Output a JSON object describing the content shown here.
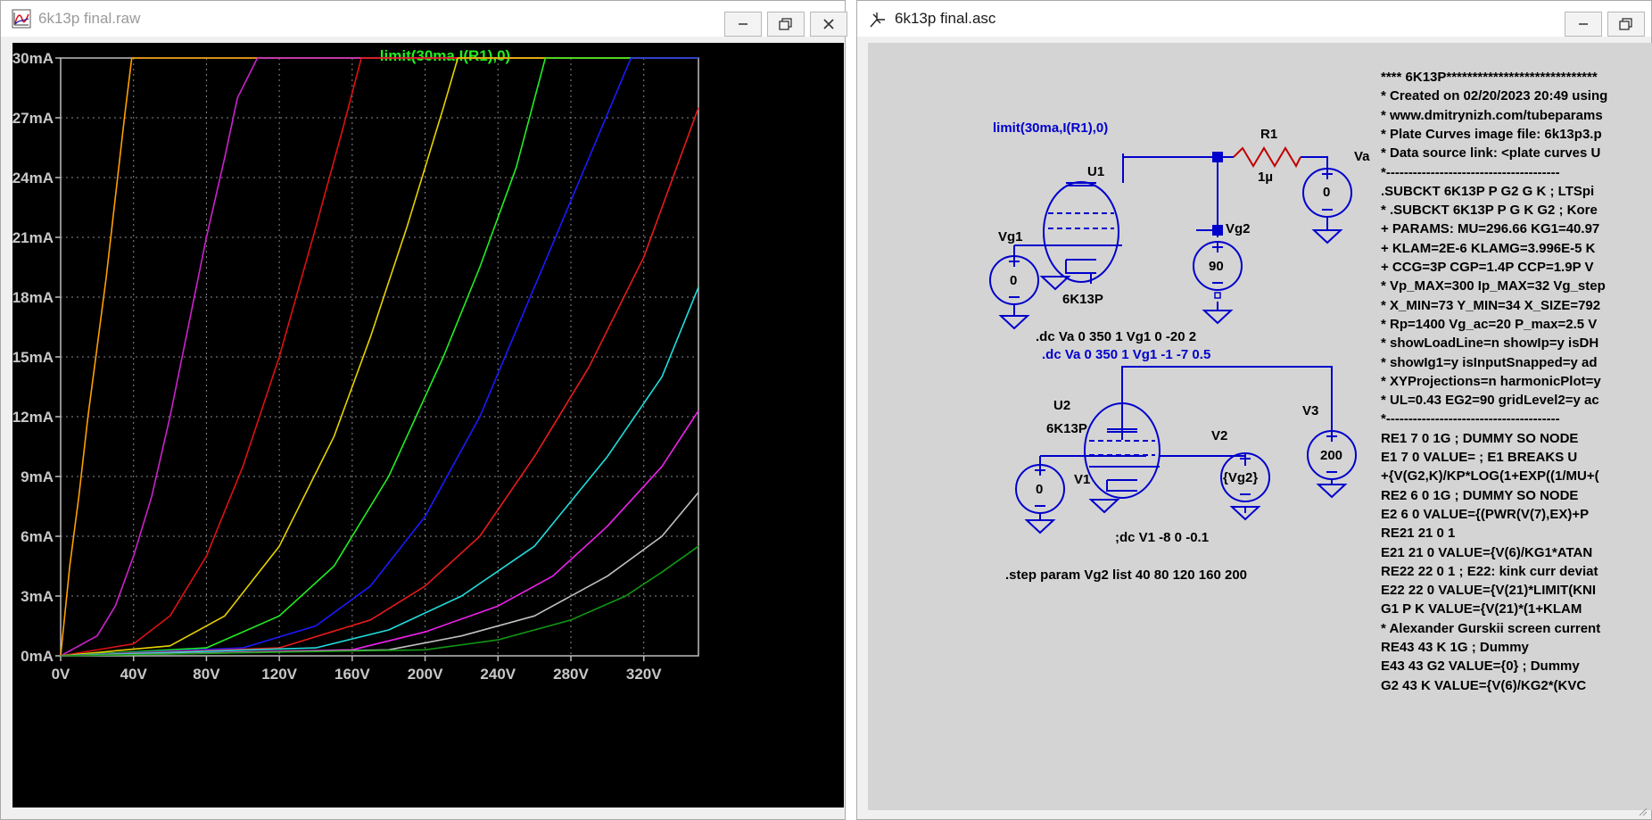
{
  "plot_window": {
    "title": "6k13p final.raw",
    "trace_label": "limit(30ma,I(R1),0)"
  },
  "schematic_window": {
    "title": "6k13p final.asc",
    "labels": {
      "expr": "limit(30ma,I(R1),0)",
      "r1": "R1",
      "r1_value": "1µ",
      "va": "Va",
      "va_value": "0",
      "u1": "U1",
      "u1_model": "6K13P",
      "vg1": "Vg1",
      "vg1_value": "0",
      "vg2": "Vg2",
      "vg2_value": "90",
      "dc1": ".dc Va 0 350 1 Vg1 0 -20 2",
      "dc2": ".dc Va 0 350 1 Vg1 -1 -7 0.5",
      "u2": "U2",
      "u2_model": "6K13P",
      "v1": "V1",
      "v1_value": "0",
      "v2": "V2",
      "v2_value": "{Vg2}",
      "v3": "V3",
      "v3_value": "200",
      "dc3": ";dc V1 -8 0 -0.1",
      "step": ".step param Vg2 list 40 80 120 160 200"
    },
    "netlist": [
      "**** 6K13P*****************************",
      "* Created on 02/20/2023 20:49 using",
      "* www.dmitrynizh.com/tubeparams",
      "* Plate Curves image file: 6k13p3.p",
      "* Data source link: <plate curves U",
      "*---------------------------------------",
      ".SUBCKT 6K13P P G2 G K ; LTSpi",
      "* .SUBCKT 6K13P P G K G2 ; Kore",
      "+ PARAMS: MU=296.66 KG1=40.97",
      "+ KLAM=2E-6 KLAMG=3.996E-5 K",
      "+ CCG=3P CGP=1.4P CCP=1.9P V",
      "* Vp_MAX=300 Ip_MAX=32 Vg_step",
      "* X_MIN=73 Y_MIN=34 X_SIZE=792",
      "* Rp=1400 Vg_ac=20 P_max=2.5 V",
      "* showLoadLine=n showIp=y isDH",
      "* showIg1=y isInputSnapped=y ad",
      "* XYProjections=n harmonicPlot=y",
      "* UL=0.43 EG2=90 gridLevel2=y ac",
      "*---------------------------------------",
      "RE1  7 0  1G    ; DUMMY SO NODE",
      "E1   7 0  VALUE=  ; E1 BREAKS U",
      "+{V(G2,K)/KP*LOG(1+EXP((1/MU+(",
      "RE2  6 0  1G    ; DUMMY SO NODE",
      "E2  6 0  VALUE={(PWR(V(7),EX)+P",
      "RE21 21 0 1",
      "E21  21 0 VALUE={V(6)/KG1*ATAN",
      "RE22 22 0 1 ; E22: kink curr deviat",
      "E22  22 0 VALUE={V(21)*LIMIT(KNI",
      "G1   P  K  VALUE={V(21)*(1+KLAM",
      "* Alexander Gurskii screen current",
      "RE43 43 K 1G ; Dummy",
      "E43  43 G2 VALUE={0} ; Dummy",
      "G2   43 K  VALUE={V(6)/KG2*(KVC"
    ]
  },
  "chart_data": {
    "type": "line",
    "title": "limit(30ma,I(R1),0)",
    "xlabel": "",
    "ylabel": "",
    "x_unit": "V",
    "y_unit": "mA",
    "xlim": [
      0,
      350
    ],
    "ylim": [
      0,
      30
    ],
    "grid": true,
    "x_ticks": [
      "0V",
      "40V",
      "80V",
      "120V",
      "160V",
      "200V",
      "240V",
      "280V",
      "320V"
    ],
    "y_ticks": [
      "0mA",
      "3mA",
      "6mA",
      "9mA",
      "12mA",
      "15mA",
      "18mA",
      "21mA",
      "24mA",
      "27mA",
      "30mA"
    ],
    "series": [
      {
        "color": "#ff9f00",
        "points": [
          [
            0,
            0
          ],
          [
            5,
            4.5
          ],
          [
            10,
            8
          ],
          [
            15,
            12
          ],
          [
            20,
            15.5
          ],
          [
            25,
            19
          ],
          [
            30,
            23
          ],
          [
            35,
            27
          ],
          [
            39,
            30
          ],
          [
            350,
            30
          ]
        ]
      },
      {
        "color": "#cc22cc",
        "points": [
          [
            0,
            0
          ],
          [
            20,
            1
          ],
          [
            30,
            2.5
          ],
          [
            40,
            5
          ],
          [
            50,
            8
          ],
          [
            60,
            12
          ],
          [
            70,
            16.5
          ],
          [
            80,
            21
          ],
          [
            90,
            25
          ],
          [
            97,
            28
          ],
          [
            108,
            30
          ],
          [
            350,
            30
          ]
        ]
      },
      {
        "color": "#dd1111",
        "points": [
          [
            0,
            0
          ],
          [
            40,
            0.6
          ],
          [
            60,
            2
          ],
          [
            80,
            5
          ],
          [
            100,
            9.5
          ],
          [
            120,
            15
          ],
          [
            140,
            21.5
          ],
          [
            155,
            26.5
          ],
          [
            165,
            30
          ],
          [
            350,
            30
          ]
        ]
      },
      {
        "color": "#e8d200",
        "points": [
          [
            0,
            0
          ],
          [
            60,
            0.5
          ],
          [
            90,
            2
          ],
          [
            120,
            5.5
          ],
          [
            150,
            11
          ],
          [
            170,
            16
          ],
          [
            190,
            21.5
          ],
          [
            210,
            27.5
          ],
          [
            218,
            30
          ],
          [
            350,
            30
          ]
        ]
      },
      {
        "color": "#22ee22",
        "points": [
          [
            0,
            0
          ],
          [
            80,
            0.4
          ],
          [
            120,
            2
          ],
          [
            150,
            4.5
          ],
          [
            180,
            9
          ],
          [
            210,
            15
          ],
          [
            230,
            19.5
          ],
          [
            250,
            24.5
          ],
          [
            266,
            30
          ],
          [
            350,
            30
          ]
        ]
      },
      {
        "color": "#1a1aff",
        "points": [
          [
            0,
            0
          ],
          [
            100,
            0.4
          ],
          [
            140,
            1.5
          ],
          [
            170,
            3.5
          ],
          [
            200,
            7
          ],
          [
            230,
            12
          ],
          [
            260,
            18.5
          ],
          [
            290,
            25
          ],
          [
            313,
            30
          ],
          [
            350,
            30
          ]
        ]
      },
      {
        "color": "#e81a1a",
        "points": [
          [
            0,
            0
          ],
          [
            120,
            0.4
          ],
          [
            170,
            1.8
          ],
          [
            200,
            3.5
          ],
          [
            230,
            6
          ],
          [
            260,
            10
          ],
          [
            290,
            14.5
          ],
          [
            320,
            20
          ],
          [
            350,
            27.5
          ]
        ]
      },
      {
        "color": "#22dddd",
        "points": [
          [
            0,
            0
          ],
          [
            140,
            0.4
          ],
          [
            180,
            1.3
          ],
          [
            220,
            3
          ],
          [
            260,
            5.5
          ],
          [
            300,
            10
          ],
          [
            330,
            14
          ],
          [
            350,
            18.5
          ]
        ]
      },
      {
        "color": "#ee22ee",
        "points": [
          [
            0,
            0
          ],
          [
            160,
            0.3
          ],
          [
            200,
            1.2
          ],
          [
            240,
            2.5
          ],
          [
            270,
            4
          ],
          [
            300,
            6.5
          ],
          [
            330,
            9.5
          ],
          [
            350,
            12.3
          ]
        ]
      },
      {
        "color": "#c0c0c0",
        "points": [
          [
            0,
            0
          ],
          [
            180,
            0.3
          ],
          [
            220,
            1
          ],
          [
            260,
            2
          ],
          [
            300,
            4
          ],
          [
            330,
            6
          ],
          [
            350,
            8.2
          ]
        ]
      },
      {
        "color": "#119911",
        "points": [
          [
            0,
            0
          ],
          [
            200,
            0.3
          ],
          [
            240,
            0.8
          ],
          [
            280,
            1.8
          ],
          [
            310,
            3
          ],
          [
            330,
            4.2
          ],
          [
            350,
            5.5
          ]
        ]
      }
    ]
  }
}
